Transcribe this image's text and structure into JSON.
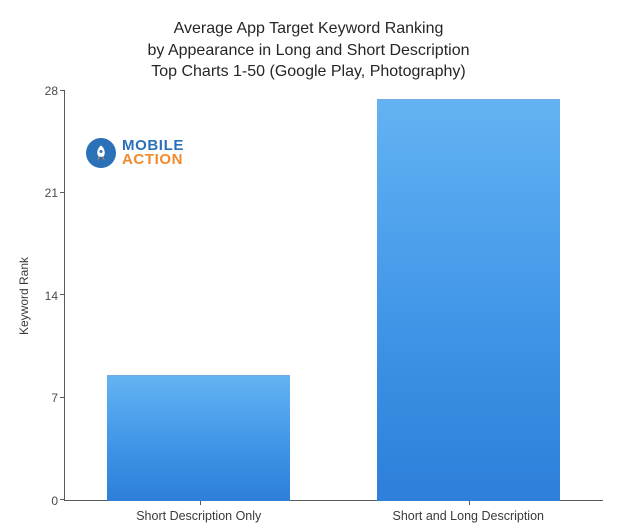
{
  "chart_data": {
    "type": "bar",
    "title": "Average App Target Keyword Ranking\nby Appearance in Long and Short Description\nTop Charts 1-50 (Google Play, Photography)",
    "ylabel": "Keyword Rank",
    "xlabel": "",
    "categories": [
      "Short Description Only",
      "Short and Long Description"
    ],
    "values": [
      8.5,
      27.4
    ],
    "ylim": [
      0,
      28
    ],
    "yticks": [
      0,
      7,
      14,
      21,
      28
    ]
  },
  "branding": {
    "name_line1": "MOBILE",
    "name_line2": "ACTION",
    "icon": "rocket-icon"
  }
}
